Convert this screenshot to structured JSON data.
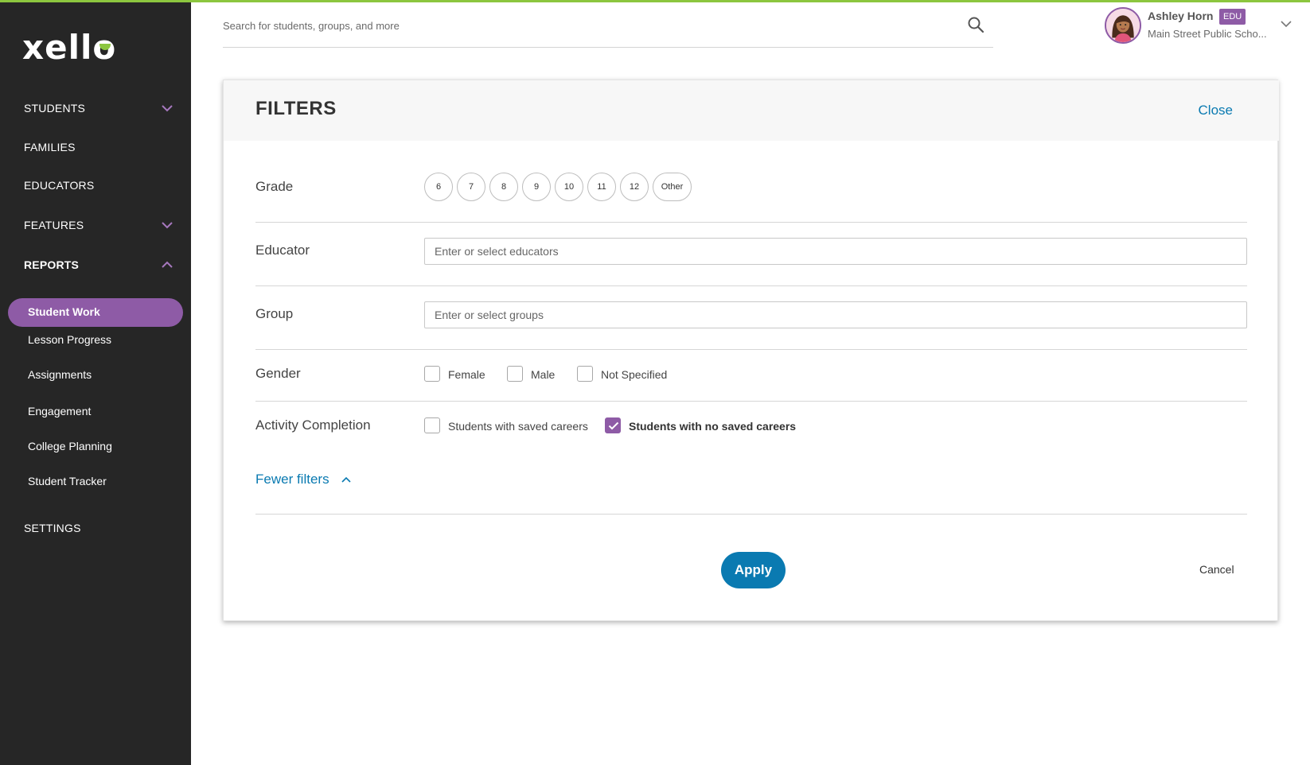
{
  "app": {
    "logo_text": "xello",
    "accent_color": "#8cc63f",
    "brand_purple": "#8e5ba6",
    "link_blue": "#0a7ab1"
  },
  "sidebar": {
    "nav": [
      {
        "label": "STUDENTS",
        "expandable": true,
        "expanded": false
      },
      {
        "label": "FAMILIES",
        "expandable": false
      },
      {
        "label": "EDUCATORS",
        "expandable": false
      },
      {
        "label": "FEATURES",
        "expandable": true,
        "expanded": false
      },
      {
        "label": "REPORTS",
        "expandable": true,
        "expanded": true
      },
      {
        "label": "SETTINGS",
        "expandable": false
      }
    ],
    "reports_items": [
      {
        "label": "Student Work",
        "active": true
      },
      {
        "label": "Lesson Progress"
      },
      {
        "label": "Assignments"
      },
      {
        "label": "Engagement"
      },
      {
        "label": "College Planning"
      },
      {
        "label": "Student Tracker"
      }
    ]
  },
  "header": {
    "search_placeholder": "Search for students, groups, and more",
    "user": {
      "name": "Ashley Horn",
      "badge": "EDU",
      "school": "Main Street Public Scho..."
    }
  },
  "filters": {
    "title": "FILTERS",
    "close_label": "Close",
    "grade": {
      "label": "Grade",
      "options": [
        "6",
        "7",
        "8",
        "9",
        "10",
        "11",
        "12",
        "Other"
      ]
    },
    "educator": {
      "label": "Educator",
      "placeholder": "Enter or select educators"
    },
    "group": {
      "label": "Group",
      "placeholder": "Enter or select groups"
    },
    "gender": {
      "label": "Gender",
      "options": [
        {
          "label": "Female",
          "checked": false
        },
        {
          "label": "Male",
          "checked": false
        },
        {
          "label": "Not Specified",
          "checked": false
        }
      ]
    },
    "activity_completion": {
      "label": "Activity Completion",
      "options": [
        {
          "label": "Students with saved careers",
          "checked": false
        },
        {
          "label": "Students with no saved careers",
          "checked": true
        }
      ]
    },
    "fewer_filters_label": "Fewer filters",
    "apply_label": "Apply",
    "cancel_label": "Cancel"
  }
}
